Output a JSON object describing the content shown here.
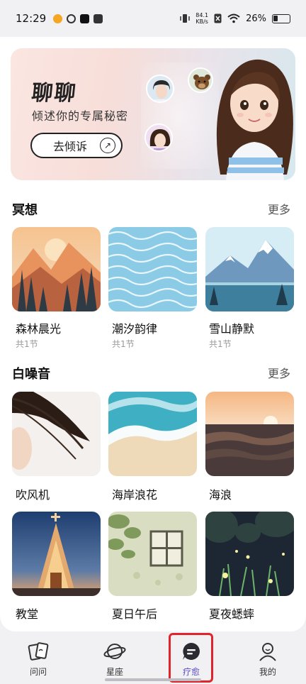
{
  "status_bar": {
    "time": "12:29",
    "net_speed_value": "84.1",
    "net_speed_unit": "KB/s",
    "battery": "26%"
  },
  "banner": {
    "title": "聊聊",
    "subtitle": "倾述你的专属秘密",
    "button_label": "去倾诉",
    "button_arrow": "↗"
  },
  "meditation": {
    "title": "冥想",
    "more": "更多",
    "items": [
      {
        "label": "森林晨光",
        "meta": "共1节"
      },
      {
        "label": "潮汐韵律",
        "meta": "共1节"
      },
      {
        "label": "雪山静默",
        "meta": "共1节"
      }
    ]
  },
  "white_noise": {
    "title": "白噪音",
    "more": "更多",
    "items": [
      {
        "label": "吹风机"
      },
      {
        "label": "海岸浪花"
      },
      {
        "label": "海浪"
      },
      {
        "label": "教堂"
      },
      {
        "label": "夏日午后"
      },
      {
        "label": "夏夜蟋蟀"
      }
    ]
  },
  "bottom_nav": {
    "items": [
      {
        "label": "问问",
        "icon": "cards-icon"
      },
      {
        "label": "星座",
        "icon": "planet-icon"
      },
      {
        "label": "疗愈",
        "icon": "chat-bubble-icon"
      },
      {
        "label": "我的",
        "icon": "profile-icon"
      }
    ],
    "active_index": 2
  },
  "colors": {
    "accent": "#5a4bc8",
    "highlight": "#e0242c"
  }
}
